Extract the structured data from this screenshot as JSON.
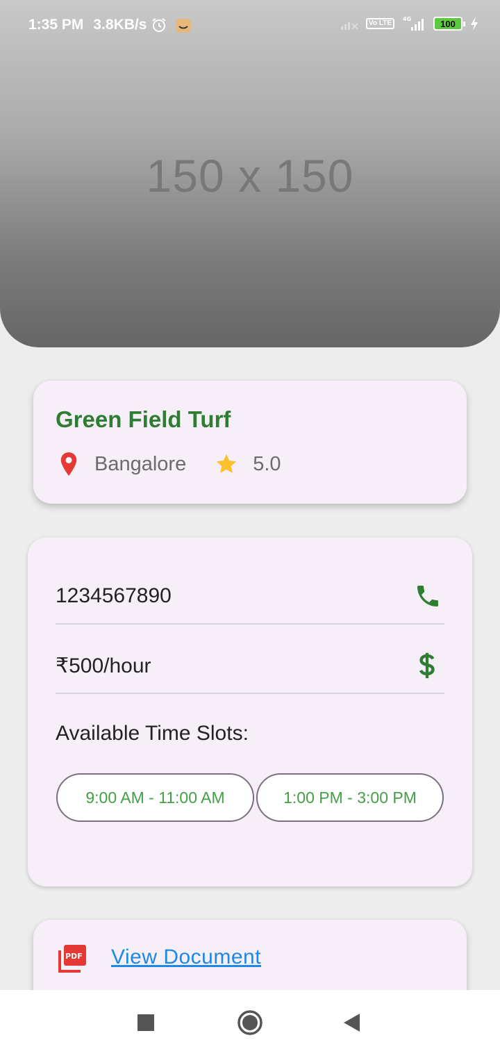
{
  "status_bar": {
    "time": "1:35 PM",
    "speed": "3.8KB/s",
    "network": "4G",
    "volte": "Vo LTE",
    "battery": "100"
  },
  "hero": {
    "placeholder": "150 x 150"
  },
  "turf": {
    "name": "Green Field Turf",
    "location": "Bangalore",
    "rating": "5.0"
  },
  "details": {
    "phone": "1234567890",
    "price": "₹500/hour",
    "slots_label": "Available Time Slots:",
    "slots": [
      "9:00 AM - 11:00 AM",
      "1:00 PM - 3:00 PM"
    ]
  },
  "document": {
    "link_label": "View Document",
    "icon_text": "PDF"
  },
  "colors": {
    "title_green": "#2e7d32",
    "slot_green": "#43a047",
    "link_blue": "#1e88e5",
    "pin_red": "#e53935",
    "star_yellow": "#fbc02d",
    "card_bg": "#f6eff8"
  }
}
